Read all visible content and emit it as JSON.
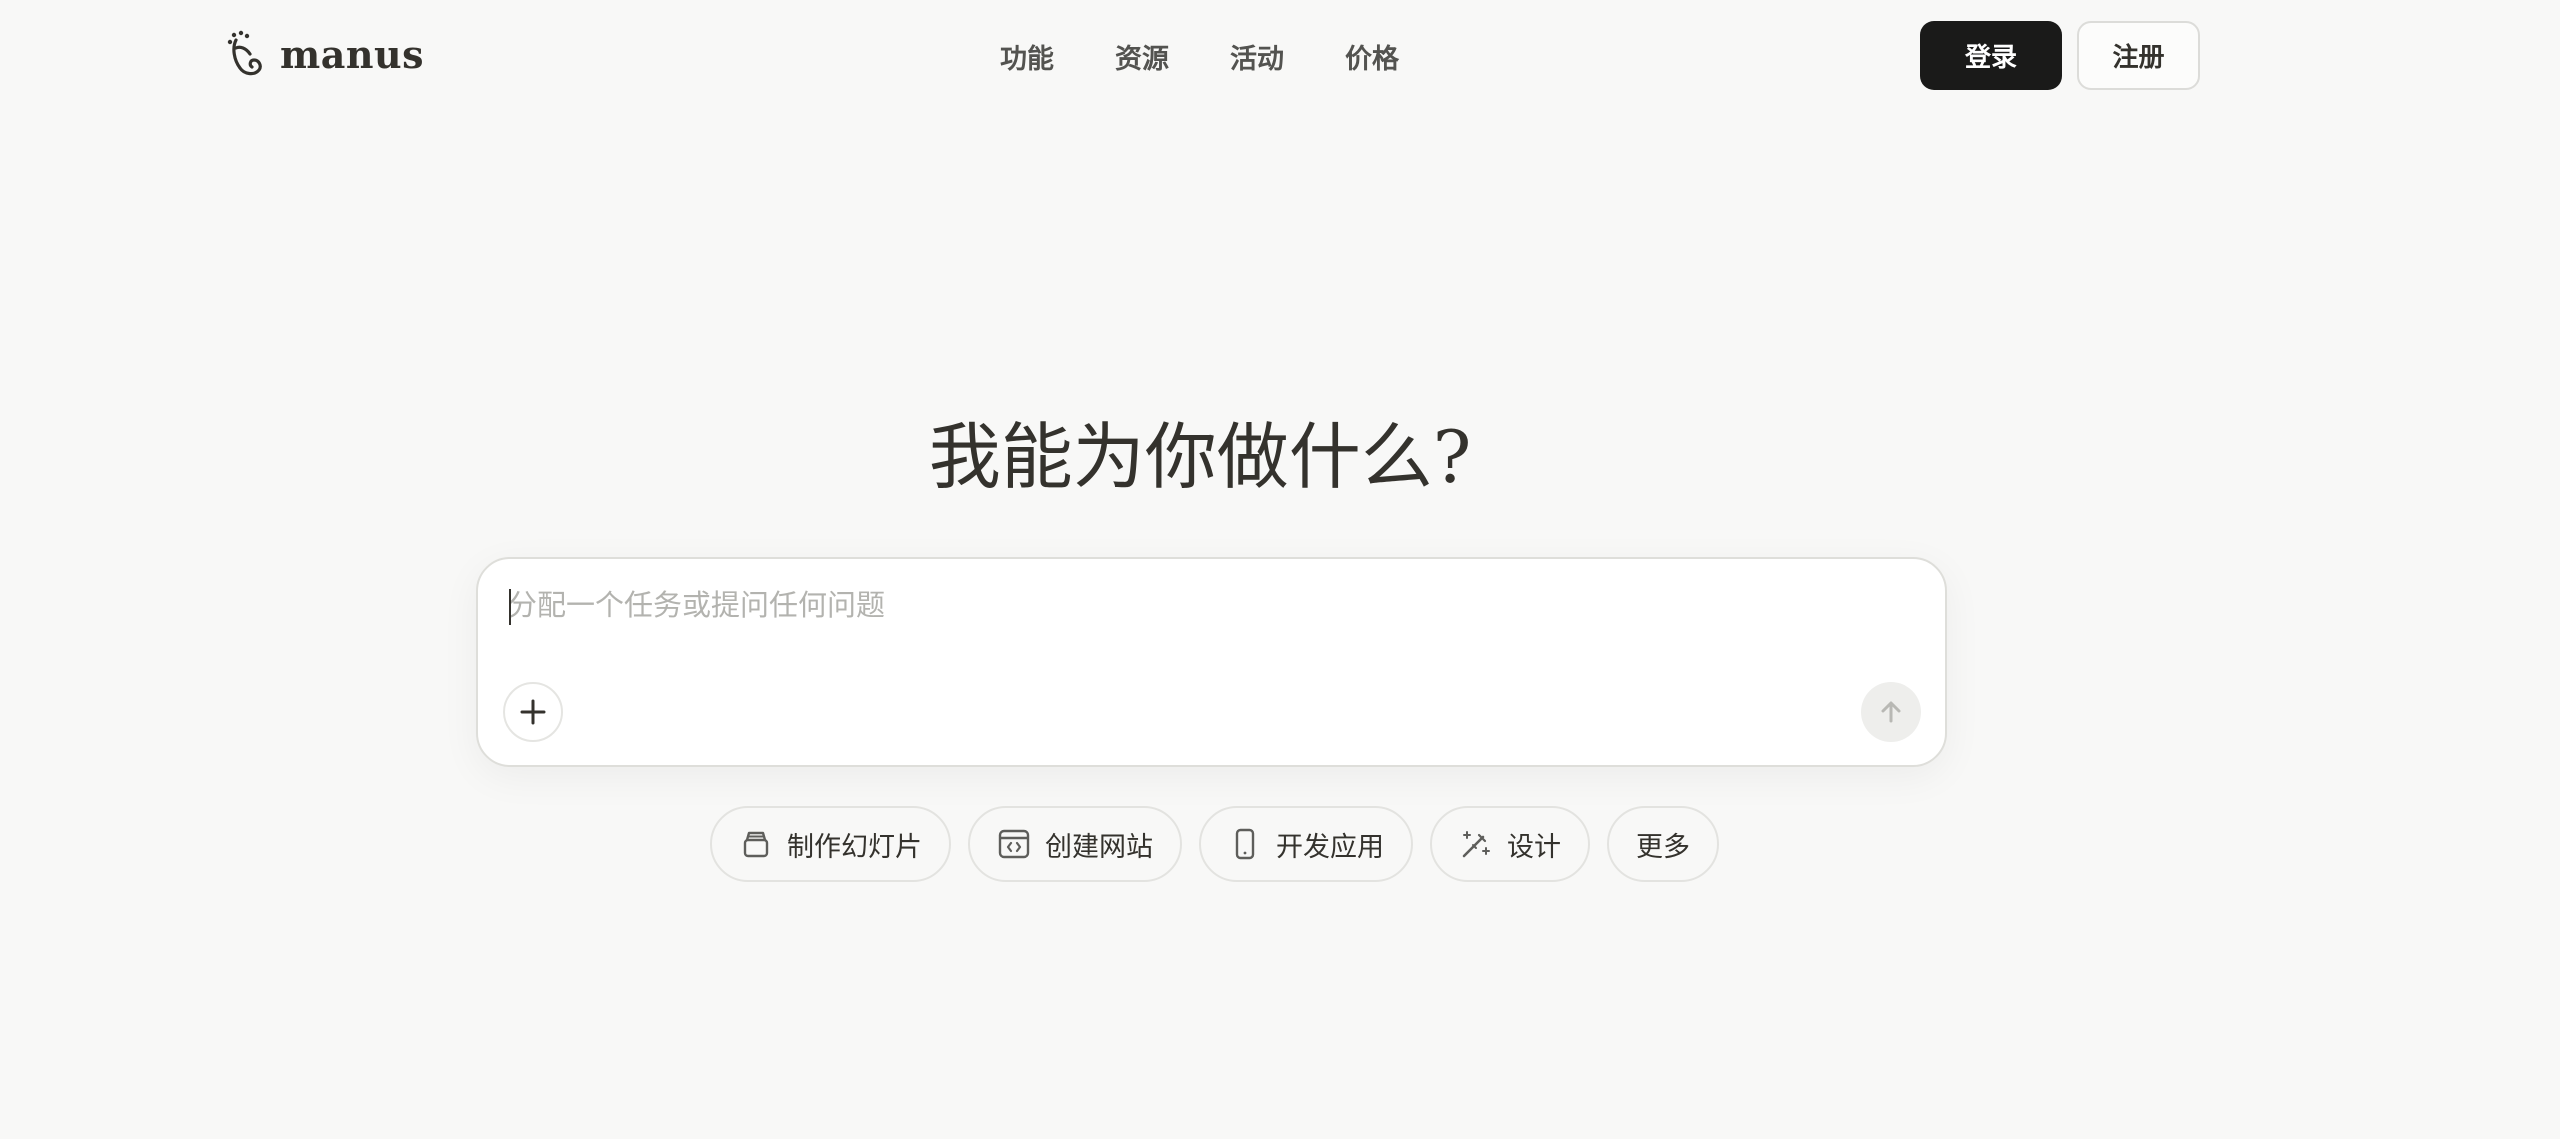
{
  "header": {
    "logo_text": "manus",
    "nav": [
      {
        "label": "功能"
      },
      {
        "label": "资源"
      },
      {
        "label": "活动"
      },
      {
        "label": "价格"
      }
    ],
    "login_label": "登录",
    "register_label": "注册"
  },
  "hero": {
    "title": "我能为你做什么?"
  },
  "composer": {
    "value": "",
    "placeholder": "分配一个任务或提问任何问题",
    "plus_icon": "plus-icon",
    "send_icon": "arrow-up-icon"
  },
  "chips": [
    {
      "label": "制作幻灯片",
      "icon": "slides-icon"
    },
    {
      "label": "创建网站",
      "icon": "browser-code-icon"
    },
    {
      "label": "开发应用",
      "icon": "smartphone-icon"
    },
    {
      "label": "设计",
      "icon": "magic-wand-icon"
    },
    {
      "label": "更多"
    }
  ],
  "colors": {
    "background": "#f8f8f7",
    "primary_button": "#1a1a19",
    "text": "#34322d",
    "placeholder": "#b3b3af"
  }
}
